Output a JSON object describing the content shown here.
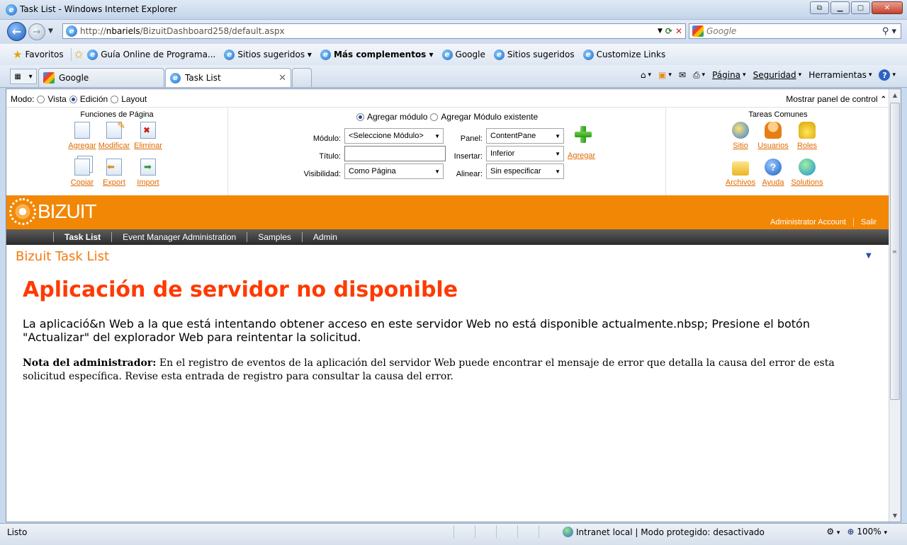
{
  "window": {
    "title": "Task List - Windows Internet Explorer"
  },
  "address": {
    "url_prefix": "http://",
    "url_host": "nbariels",
    "url_path": "/BizuitDashboard258/default.aspx",
    "search_placeholder": "Google"
  },
  "favorites": {
    "label": "Favoritos",
    "items": [
      {
        "label": "Guía Online de Programa...",
        "bold": false
      },
      {
        "label": "Sitios sugeridos ▾",
        "bold": false
      },
      {
        "label": "Más complementos ▾",
        "bold": true
      },
      {
        "label": "Google",
        "bold": false
      },
      {
        "label": "Sitios sugeridos",
        "bold": false
      },
      {
        "label": "Customize Links",
        "bold": false
      }
    ]
  },
  "tabs": {
    "inactive": "Google",
    "active": "Task List"
  },
  "commands": {
    "page": "Página",
    "safety": "Seguridad",
    "tools": "Herramientas"
  },
  "control_panel": {
    "mode_label": "Modo:",
    "mode_options": [
      "Vista",
      "Edición",
      "Layout"
    ],
    "mode_selected": "Edición",
    "show_panel": "Mostrar panel de control",
    "page_functions": {
      "title": "Funciones de Página",
      "actions": [
        "Agregar",
        "Modificar",
        "Eliminar",
        "Copiar",
        "Export",
        "Import"
      ]
    },
    "module": {
      "radio_add": "Agregar módulo",
      "radio_existing": "Agregar Módulo existente",
      "module_label": "Módulo:",
      "module_value": "<Seleccione Módulo>",
      "title_label": "Título:",
      "title_value": "",
      "visibility_label": "Visibilidad:",
      "visibility_value": "Como Página",
      "panel_label": "Panel:",
      "panel_value": "ContentPane",
      "insert_label": "Insertar:",
      "insert_value": "Inferior",
      "align_label": "Alinear:",
      "align_value": "Sin especificar",
      "add_button": "Agregar"
    },
    "common_tasks": {
      "title": "Tareas Comunes",
      "items": [
        "Sitio",
        "Usuarios",
        "Roles",
        "Archivos",
        "Ayuda",
        "Solutions"
      ]
    }
  },
  "portal": {
    "logo_text": "BIZUIT",
    "account": "Administrator Account",
    "logout": "Salir",
    "nav": [
      "Task List",
      "Event Manager Administration",
      "Samples",
      "Admin"
    ],
    "module_title": "Bizuit Task List"
  },
  "error": {
    "heading": "Aplicación de servidor no disponible",
    "description": "La aplicació&n Web a la que está intentando obtener acceso en este servidor Web no está disponible actualmente.nbsp; Presione el botón \"Actualizar\" del explorador Web para reintentar la solicitud.",
    "note_label": "Nota del administrador:",
    "note_text": " En el registro de eventos de la aplicación del servidor Web puede encontrar el mensaje de error que detalla la causa del error de esta solicitud específica. Revise esta entrada de registro para consultar la causa del error."
  },
  "status": {
    "left": "Listo",
    "zone": "Intranet local | Modo protegido: desactivado",
    "zoom": "100%"
  }
}
